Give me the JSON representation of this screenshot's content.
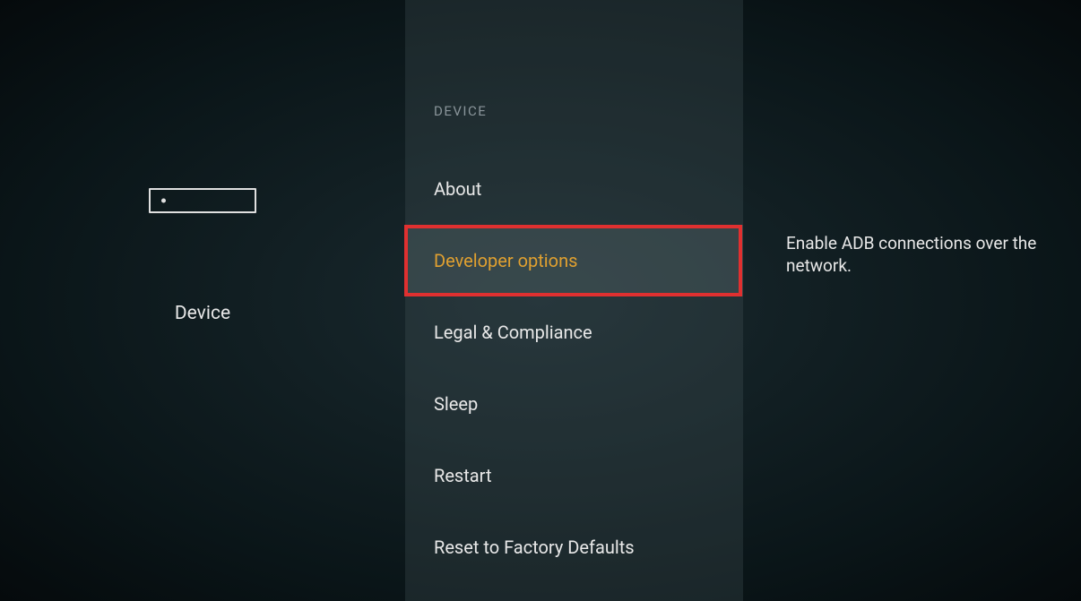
{
  "left": {
    "title": "Device"
  },
  "menu": {
    "header": "DEVICE",
    "items": [
      {
        "label": "About",
        "selected": false
      },
      {
        "label": "Developer options",
        "selected": true
      },
      {
        "label": "Legal & Compliance",
        "selected": false
      },
      {
        "label": "Sleep",
        "selected": false
      },
      {
        "label": "Restart",
        "selected": false
      },
      {
        "label": "Reset to Factory Defaults",
        "selected": false
      }
    ]
  },
  "detail": {
    "description": "Enable ADB connections over the network."
  },
  "annotation": {
    "highlight_index": 1,
    "highlight_color": "#e03030"
  }
}
